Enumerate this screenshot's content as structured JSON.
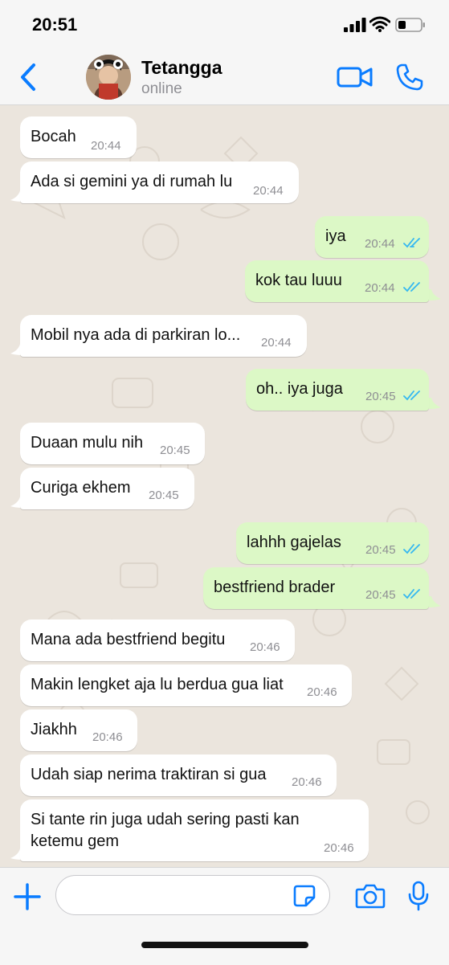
{
  "status_bar": {
    "time": "20:51"
  },
  "header": {
    "contact_name": "Tetangga",
    "contact_status": "online"
  },
  "messages": [
    {
      "text": "Bocah",
      "time": "20:44",
      "direction": "in"
    },
    {
      "text": "Ada si gemini ya di rumah lu",
      "time": "20:44",
      "direction": "in"
    },
    {
      "text": "iya",
      "time": "20:44",
      "direction": "out",
      "read": true
    },
    {
      "text": "kok tau luuu",
      "time": "20:44",
      "direction": "out",
      "read": true
    },
    {
      "text": "Mobil nya ada di parkiran lo...",
      "time": "20:44",
      "direction": "in"
    },
    {
      "text": "oh.. iya juga",
      "time": "20:45",
      "direction": "out",
      "read": true
    },
    {
      "text": "Duaan mulu nih",
      "time": "20:45",
      "direction": "in"
    },
    {
      "text": "Curiga ekhem",
      "time": "20:45",
      "direction": "in"
    },
    {
      "text": "lahhh gajelas",
      "time": "20:45",
      "direction": "out",
      "read": true
    },
    {
      "text": "bestfriend brader",
      "time": "20:45",
      "direction": "out",
      "read": true
    },
    {
      "text": "Mana ada bestfriend begitu",
      "time": "20:46",
      "direction": "in"
    },
    {
      "text": "Makin lengket aja lu berdua gua liat",
      "time": "20:46",
      "direction": "in"
    },
    {
      "text": "Jiakhh",
      "time": "20:46",
      "direction": "in"
    },
    {
      "text": "Udah siap nerima traktiran si gua",
      "time": "20:46",
      "direction": "in"
    },
    {
      "text_line1": "Si tante rin juga udah sering pasti kan",
      "text_line2": "ketemu gem",
      "time": "20:46",
      "direction": "in"
    }
  ],
  "composer": {
    "input_value": ""
  },
  "colors": {
    "accent": "#0a7cff",
    "outgoing_bubble": "#dcf8c6",
    "incoming_bubble": "#ffffff",
    "chat_background": "#ebe5dd",
    "read_ticks": "#34b7f1"
  },
  "icons": [
    "back-chevron-icon",
    "video-call-icon",
    "voice-call-icon",
    "plus-icon",
    "sticker-icon",
    "camera-icon",
    "microphone-icon",
    "double-check-icon"
  ]
}
